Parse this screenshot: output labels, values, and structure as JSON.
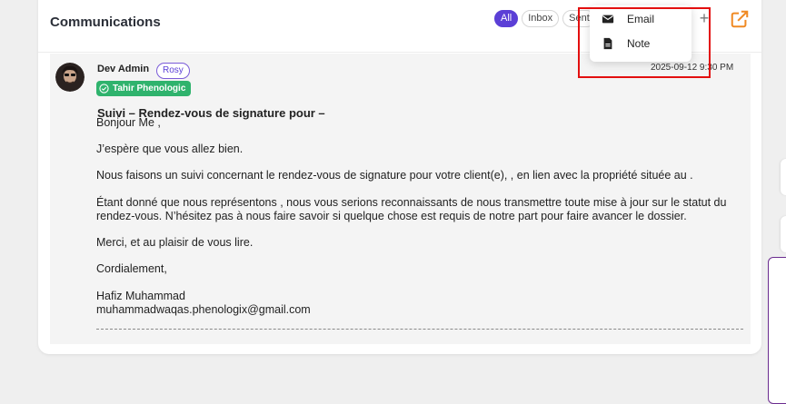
{
  "header": {
    "title": "Communications"
  },
  "filters": [
    {
      "label": "All",
      "active": true
    },
    {
      "label": "Inbox",
      "active": false
    },
    {
      "label": "Sent",
      "active": false
    }
  ],
  "dropdown": {
    "items": [
      {
        "label": "Email",
        "icon": "email-icon"
      },
      {
        "label": "Note",
        "icon": "note-icon"
      }
    ]
  },
  "message": {
    "sender": "Dev Admin",
    "recipient_tag": "Rosy",
    "company_tag": "Tahir Phenologic",
    "timestamp": "2025-09-12 9:30 PM",
    "subject": "Suivi – Rendez-vous de signature pour –",
    "body": {
      "greeting": "Bonjour Me ,",
      "line1": "J’espère que vous allez bien.",
      "line2": "Nous faisons un suivi concernant le rendez-vous de signature pour votre client(e), , en lien avec la propriété située au .",
      "line3a": "Étant donné que nous représentons , nous vous serions reconnaissants de nous transmettre toute mise à jour sur le statut du",
      "line3b": "rendez-vous. N’hésitez pas à nous faire savoir si quelque chose est requis de notre part pour faire avancer le dossier.",
      "line4": "Merci, et au plaisir de vous lire.",
      "closing": "Cordialement,",
      "signature_name": "Hafiz Muhammad",
      "signature_email": "muhammadwaqas.phenologix@gmail.com"
    }
  },
  "colors": {
    "accent": "#5b3fd6",
    "green": "#2fb36d",
    "highlight": "#e30f0f",
    "orange": "#f08a24"
  }
}
